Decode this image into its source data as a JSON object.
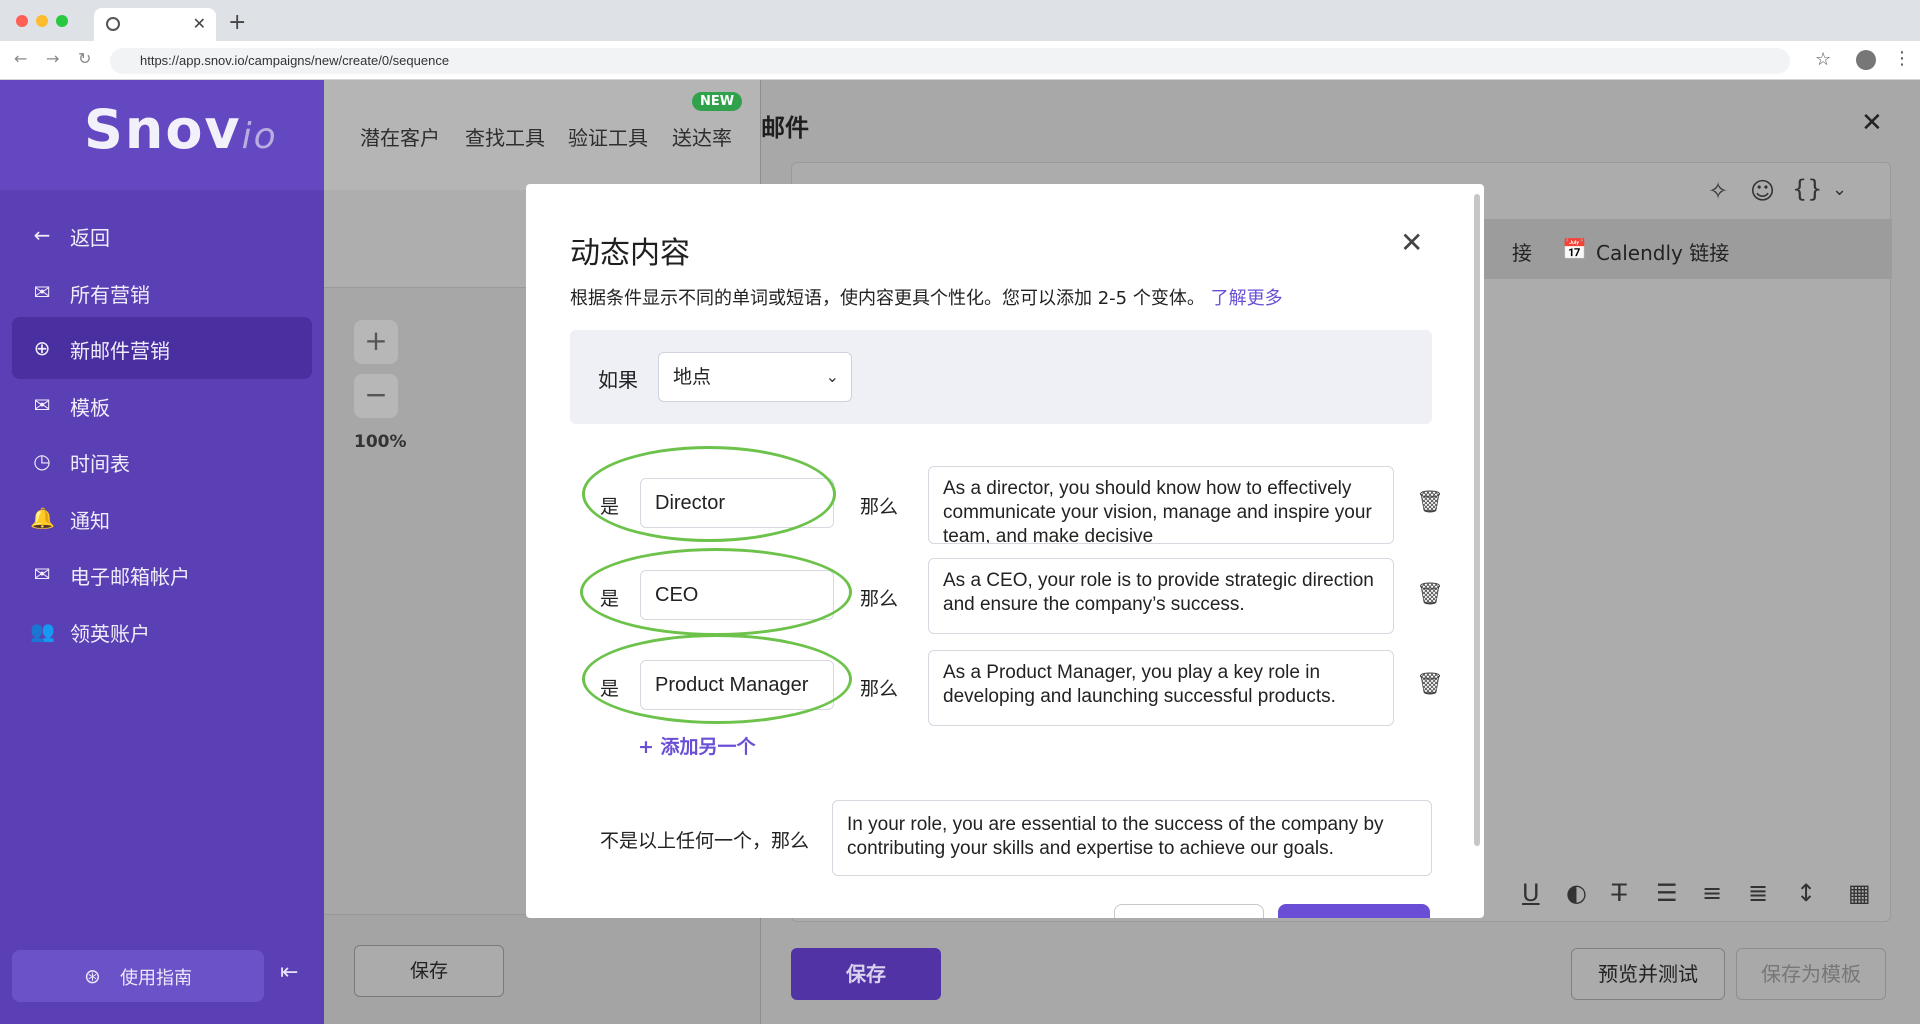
{
  "browser": {
    "url": "https://app.snov.io/campaigns/new/create/0/sequence"
  },
  "sidebar": {
    "logo_main": "Snov",
    "logo_suffix": "io",
    "items": [
      {
        "label": "返回",
        "icon": "arrow-left-icon"
      },
      {
        "label": "所有营销",
        "icon": "mail-icon"
      },
      {
        "label": "新邮件营销",
        "icon": "plus-circle-icon",
        "active": true
      },
      {
        "label": "模板",
        "icon": "mail-template-icon"
      },
      {
        "label": "时间表",
        "icon": "clock-icon"
      },
      {
        "label": "通知",
        "icon": "bell-icon"
      },
      {
        "label": "电子邮箱帐户",
        "icon": "mail-account-icon"
      },
      {
        "label": "领英账户",
        "icon": "users-icon"
      }
    ],
    "guide_label": "使用指南"
  },
  "topnav": {
    "items": [
      "潜在客户",
      "查找工具",
      "验证工具",
      "送达率"
    ],
    "new_badge": "NEW"
  },
  "main": {
    "zoom": "100%",
    "save_label": "保存"
  },
  "email_panel": {
    "title": "邮件",
    "strip_left": "接",
    "calendly": "Calendly 链接",
    "save_label": "保存",
    "preview_label": "预览并测试",
    "save_template_label": "保存为模板"
  },
  "modal": {
    "title": "动态内容",
    "description": "根据条件显示不同的单词或短语，使内容更具个性化。您可以添加 2-5 个变体。",
    "learn_more": "了解更多",
    "if_label": "如果",
    "condition_field": "地点",
    "is_label": "是",
    "then_label": "那么",
    "rows": [
      {
        "value": "Director",
        "text": "As a director, you should know how to effectively communicate your vision, manage and inspire your team, and make decisive"
      },
      {
        "value": "CEO",
        "text": "As a CEO, your role is to provide strategic direction and ensure the company’s success."
      },
      {
        "value": "Product Manager",
        "text": "As a Product Manager, you play a key role in developing and launching successful products."
      }
    ],
    "add_another": "+ 添加另一个",
    "else_label": "不是以上任何一个，那么",
    "else_text": "In your role, you are essential to the success of the company by contributing your skills and expertise to achieve our goals."
  },
  "colors": {
    "brand": "#5b3fb5",
    "accent": "#6a4fd6",
    "highlight": "#6cc24a"
  }
}
